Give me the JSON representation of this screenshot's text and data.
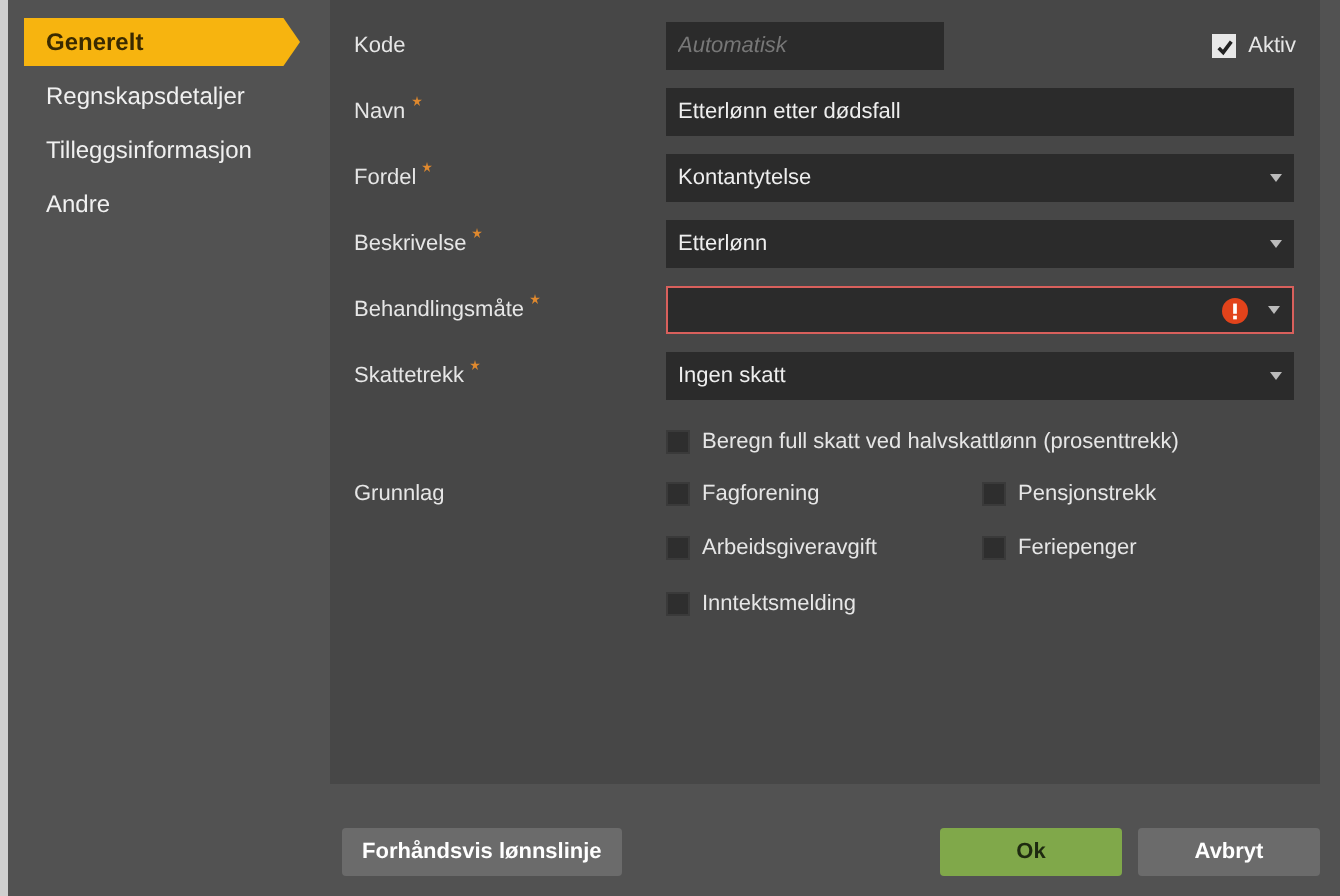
{
  "sidebar": {
    "items": [
      {
        "label": "Generelt",
        "selected": true
      },
      {
        "label": "Regnskapsdetaljer",
        "selected": false
      },
      {
        "label": "Tilleggsinformasjon",
        "selected": false
      },
      {
        "label": "Andre",
        "selected": false
      }
    ]
  },
  "form": {
    "fields": [
      {
        "label": "Kode",
        "required": false,
        "kind": "text",
        "placeholder": "Automatisk",
        "short": true
      },
      {
        "label": "Navn",
        "required": true,
        "kind": "text",
        "value": "Etterlønn etter dødsfall"
      },
      {
        "label": "Fordel",
        "required": true,
        "kind": "select",
        "value": "Kontantytelse",
        "error": false
      },
      {
        "label": "Beskrivelse",
        "required": true,
        "kind": "select",
        "value": "Etterlønn",
        "error": false
      },
      {
        "label": "Behandlingsmåte",
        "required": true,
        "kind": "select",
        "error": true
      },
      {
        "label": "Skattetrekk",
        "required": true,
        "kind": "select",
        "value": "Ingen skatt",
        "error": false
      }
    ],
    "active": {
      "label": "Aktiv",
      "checked": true
    },
    "full_tax_option": {
      "label": "Beregn full skatt ved halvskattlønn (prosenttrekk)",
      "checked": false
    },
    "grunnlag": {
      "label": "Grunnlag",
      "options": [
        {
          "label": "Fagforening",
          "checked": false
        },
        {
          "label": "Pensjonstrekk",
          "checked": false
        },
        {
          "label": "Arbeidsgiveravgift",
          "checked": false
        },
        {
          "label": "Feriepenger",
          "checked": false
        },
        {
          "label": "Inntektsmelding",
          "checked": false
        }
      ]
    }
  },
  "buttons": [
    {
      "label": "Forhåndsvis lønnslinje",
      "kind": "secondary"
    },
    {
      "label": "Ok",
      "kind": "primary"
    },
    {
      "label": "Avbryt",
      "kind": "secondary"
    }
  ]
}
